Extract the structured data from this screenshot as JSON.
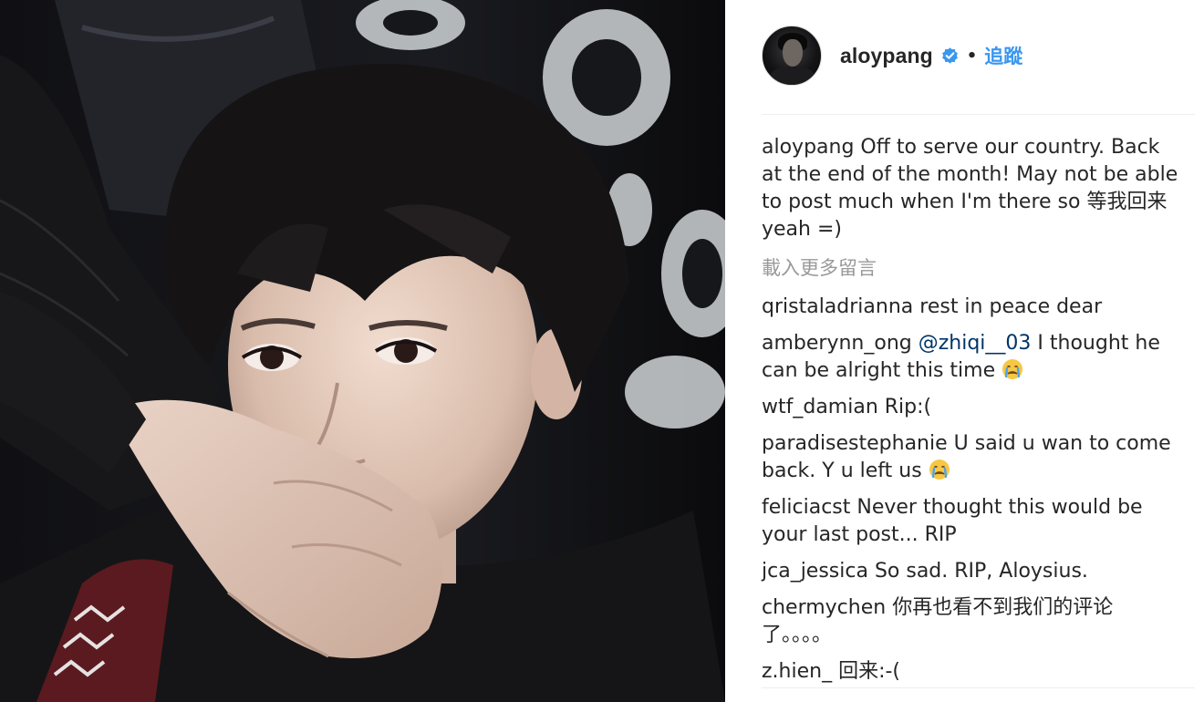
{
  "post": {
    "username": "aloypang",
    "follow_label": "追蹤",
    "separator": "•",
    "verified_icon": "verified-badge-icon",
    "accent_color": "#3897f0",
    "caption": {
      "user": "aloypang",
      "text": " Off to serve our country. Back at the end of the month! May not be able to post much when I'm there so 等我回来 yeah =)"
    },
    "load_more": "載入更多留言"
  },
  "comments": [
    {
      "user": "qristaladrianna",
      "mention": "",
      "text": " rest in peace dear",
      "emoji": ""
    },
    {
      "user": "amberynn_ong",
      "mention": " @zhiqi__03",
      "text": " I thought he can be alright this time ",
      "emoji": "crying-face-icon"
    },
    {
      "user": "wtf_damian",
      "mention": "",
      "text": " Rip:(",
      "emoji": ""
    },
    {
      "user": "paradisestephanie",
      "mention": "",
      "text": " U said u wan to come back. Y u left us ",
      "emoji": "crying-face-icon"
    },
    {
      "user": "feliciacst",
      "mention": "",
      "text": " Never thought this would be your last post... RIP",
      "emoji": ""
    },
    {
      "user": "jca_jessica",
      "mention": "",
      "text": " So sad. RIP, Aloysius.",
      "emoji": ""
    },
    {
      "user": "chermychen",
      "mention": "",
      "text": " 你再也看不到我们的评论了。。。。",
      "emoji": ""
    },
    {
      "user": "z.hien_",
      "mention": "",
      "text": " 回来:-(",
      "emoji": ""
    }
  ]
}
